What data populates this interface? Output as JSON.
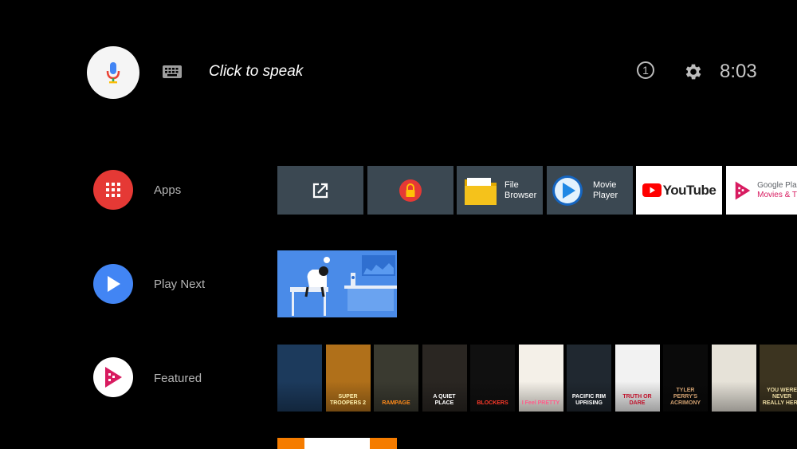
{
  "header": {
    "search_prompt": "Click to speak",
    "notification_count": "1",
    "clock": "8:03"
  },
  "rows": {
    "apps": {
      "label": "Apps"
    },
    "play_next": {
      "label": "Play Next"
    },
    "featured": {
      "label": "Featured"
    }
  },
  "apps": {
    "file_browser": [
      "File",
      "Browser"
    ],
    "movie_player": [
      "Movie",
      "Player"
    ],
    "youtube": "YouTube",
    "google_play": [
      "Google Pla",
      "Movies & T"
    ]
  },
  "posters": [
    {
      "title": "",
      "bg": "#1c3a5c",
      "fg": "#9fd6ff"
    },
    {
      "title": "SUPER TROOPERS 2",
      "bg": "#b0701a",
      "fg": "#fff2b0"
    },
    {
      "title": "RAMPAGE",
      "bg": "#3a3a30",
      "fg": "#ff8a1a"
    },
    {
      "title": "A QUIET PLACE",
      "bg": "#2a2622",
      "fg": "#ffffff"
    },
    {
      "title": "BLOCKERS",
      "bg": "#101010",
      "fg": "#ff3a2a"
    },
    {
      "title": "I Feel PRETTY",
      "bg": "#f4f0e8",
      "fg": "#ff5a8a"
    },
    {
      "title": "PACIFIC RIM UPRISING",
      "bg": "#202830",
      "fg": "#ffffff"
    },
    {
      "title": "TRUTH OR DARE",
      "bg": "#f2f2f2",
      "fg": "#c0102a"
    },
    {
      "title": "TYLER PERRY'S ACRIMONY",
      "bg": "#0a0a0a",
      "fg": "#d0a070"
    },
    {
      "title": "",
      "bg": "#e6e2d8",
      "fg": "#c02020"
    },
    {
      "title": "YOU WERE NEVER REALLY HERE",
      "bg": "#3c3420",
      "fg": "#e8d8a0"
    }
  ],
  "colors": {
    "apps_icon": "#e53935",
    "play_next_icon": "#4285f4",
    "tile_dark": "#3b4852",
    "youtube_red": "#ff0000"
  }
}
